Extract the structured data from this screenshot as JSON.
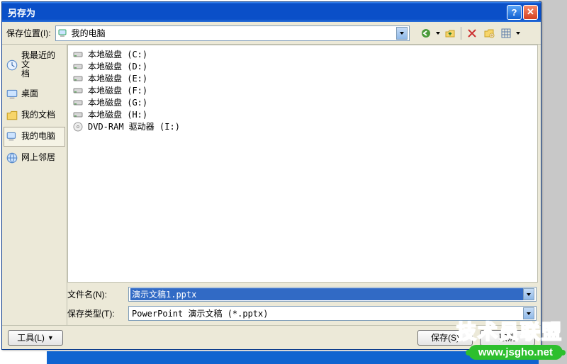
{
  "title": "另存为",
  "toolbar": {
    "location_label": "保存位置(I):",
    "location_value": "我的电脑"
  },
  "sidebar": {
    "items": [
      {
        "label": "我最近的文\n档",
        "icon": "recent-icon"
      },
      {
        "label": "桌面",
        "icon": "desktop-icon"
      },
      {
        "label": "我的文档",
        "icon": "mydocs-icon"
      },
      {
        "label": "我的电脑",
        "icon": "mycomputer-icon",
        "active": true
      },
      {
        "label": "网上邻居",
        "icon": "network-icon"
      }
    ]
  },
  "drives": [
    {
      "label": "本地磁盘 (C:)",
      "type": "disk"
    },
    {
      "label": "本地磁盘 (D:)",
      "type": "disk"
    },
    {
      "label": "本地磁盘 (E:)",
      "type": "disk"
    },
    {
      "label": "本地磁盘 (F:)",
      "type": "disk"
    },
    {
      "label": "本地磁盘 (G:)",
      "type": "disk"
    },
    {
      "label": "本地磁盘 (H:)",
      "type": "disk"
    },
    {
      "label": "DVD-RAM 驱动器 (I:)",
      "type": "dvd"
    }
  ],
  "fields": {
    "filename_label": "文件名(N):",
    "filename_value": "演示文稿1.pptx",
    "filetype_label": "保存类型(T):",
    "filetype_value": "PowerPoint 演示文稿 (*.pptx)"
  },
  "footer": {
    "tools_label": "工具(L)",
    "save_label": "保存(S)",
    "cancel_label": "取消"
  },
  "watermark": {
    "line1": "技术员联盟",
    "line2": "www.jsgho.net"
  }
}
